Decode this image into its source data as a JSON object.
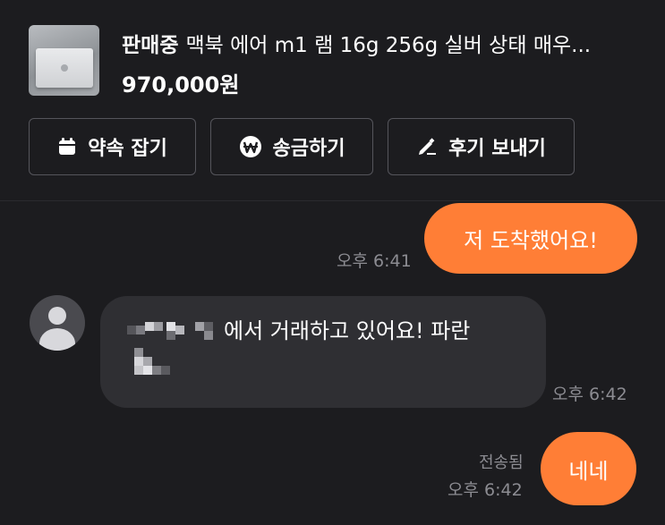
{
  "product": {
    "status": "판매중",
    "title": "맥북 에어 m1 램 16g 256g 실버 상태 매우...",
    "price": "970,000원"
  },
  "actions": {
    "schedule_label": "약속 잡기",
    "send_money_label": "송금하기",
    "review_label": "후기 보내기"
  },
  "messages": [
    {
      "direction": "outgoing",
      "text": "저 도착했어요!",
      "time": "오후 6:41"
    },
    {
      "direction": "incoming",
      "text_line1": "에서 거래하고 있어요! 파란",
      "time": "오후 6:42"
    },
    {
      "direction": "outgoing",
      "text": "네네",
      "read_status": "전송됨",
      "time": "오후 6:42"
    }
  ],
  "colors": {
    "background": "#1c1c1f",
    "accent": "#ff7e36",
    "incoming_bubble": "#2f2f33",
    "muted_text": "#8c8c92"
  },
  "icons": {
    "schedule": "calendar-icon",
    "send_money": "won-coin-icon",
    "review": "pencil-icon"
  }
}
